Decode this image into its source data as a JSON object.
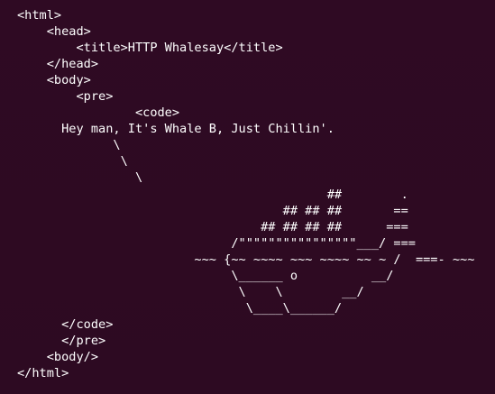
{
  "terminal": {
    "lines": [
      "<html>",
      "    <head>",
      "        <title>HTTP Whalesay</title>",
      "    </head>",
      "    <body>",
      "        <pre>",
      "                <code>",
      "      Hey man, It's Whale B, Just Chillin'.",
      "             \\",
      "              \\",
      "                \\",
      "                                          ##        .",
      "                                    ## ## ##       ==",
      "                                 ## ## ## ##      ===",
      "                             /\"\"\"\"\"\"\"\"\"\"\"\"\"\"\"\"___/ ===",
      "                        ~~~ {~~ ~~~~ ~~~ ~~~~ ~~ ~ /  ===- ~~~",
      "                             \\______ o          __/",
      "                              \\    \\        __/",
      "                               \\____\\______/",
      "      </code>",
      "      </pre>",
      "    <body/>",
      "</html>"
    ]
  }
}
